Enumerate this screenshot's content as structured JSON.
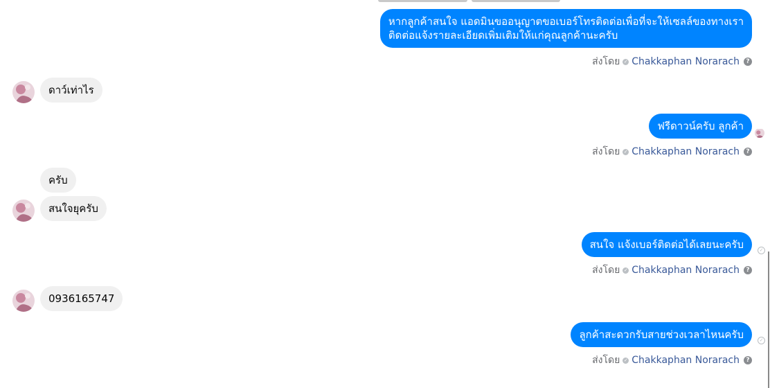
{
  "conversation": {
    "sent_by_label": "ส่งโดย",
    "sender_name": "Chakkaphan Norarach",
    "messages": [
      {
        "text": "หากลูกค้าสนใจ แอดมินขออนุญาตขอเบอร์โทรติดต่อเพื่อที่จะให้เซลล์ของทางเรา\nติดต่อแจ้งรายละเอียดเพิ่มเติมให้แก่คุณลูกค้านะครับ"
      },
      {
        "text": "ดาว์เท่าไร"
      },
      {
        "text": "ฟรีดาวน์ครับ ลูกค้า"
      },
      {
        "text": "ครับ"
      },
      {
        "text": "สนใจยุครับ"
      },
      {
        "text": "สนใจ แจ้งเบอร์ติดต่อได้เลยนะครับ"
      },
      {
        "text": "0936165747"
      },
      {
        "text": "ลูกค้าสะดวกรับสายช่วงเวลาไหนครับ"
      }
    ]
  },
  "icons": {
    "help": "?",
    "verified_check": "✓",
    "delivered_check": "✓"
  },
  "colors": {
    "outgoing_bubble": "#0084ff",
    "incoming_bubble": "#f0f0f0",
    "link_name": "#385898"
  }
}
